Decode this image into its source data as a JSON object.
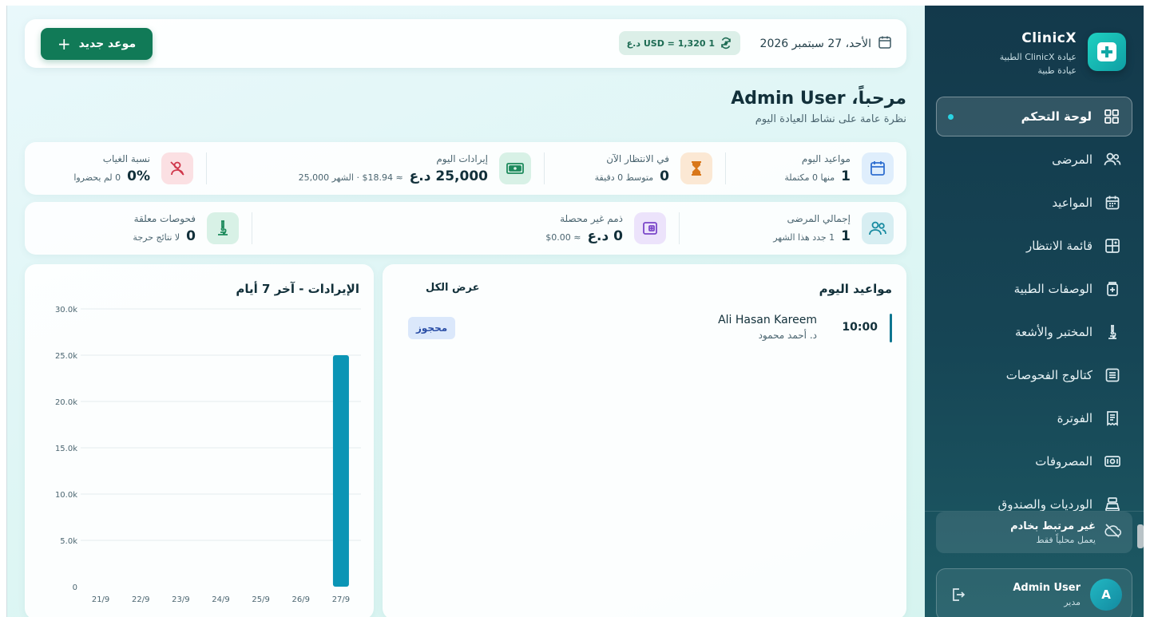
{
  "sidebar": {
    "brand_name": "ClinicX",
    "brand_sub1": "عيادة ClinicX الطبية",
    "brand_sub2": "عيادة طبية",
    "items": [
      {
        "label": "لوحة التحكم",
        "icon": "dashboard-icon",
        "active": true
      },
      {
        "label": "المرضى",
        "icon": "patients-icon"
      },
      {
        "label": "المواعيد",
        "icon": "calendar-icon"
      },
      {
        "label": "قائمة الانتظار",
        "icon": "queue-icon"
      },
      {
        "label": "الوصفات الطبية",
        "icon": "prescription-icon"
      },
      {
        "label": "المختبر والأشعة",
        "icon": "microscope-icon"
      },
      {
        "label": "كتالوج الفحوصات",
        "icon": "catalog-icon"
      },
      {
        "label": "الفوترة",
        "icon": "invoice-icon"
      },
      {
        "label": "المصروفات",
        "icon": "expenses-icon"
      },
      {
        "label": "الورديات والصندوق",
        "icon": "cash-register-icon"
      }
    ],
    "offline_title": "غير مرتبط بخادم",
    "offline_sub": "يعمل محلياً فقط",
    "user_name": "Admin User",
    "user_role": "مدير",
    "user_initial": "A"
  },
  "topbar": {
    "date": "الأحد، 27 سبتمبر 2026",
    "rate": "1 USD = 1,320 د.ع",
    "new_appointment": "موعد جديد"
  },
  "welcome": {
    "greeting": "مرحباً،",
    "name": "Admin User",
    "subtitle": "نظرة عامة على نشاط العيادة اليوم"
  },
  "stats_row1": [
    {
      "label": "مواعيد اليوم",
      "value": "1",
      "sub": "منها 0 مكتملة",
      "icon": "calendar-icon",
      "color": "#2f6fd0"
    },
    {
      "label": "في الانتظار الآن",
      "value": "0",
      "sub": "متوسط 0 دقيقة",
      "icon": "hourglass-icon",
      "color": "#d9771a"
    },
    {
      "label": "إيرادات اليوم",
      "value": "25,000 د.ع",
      "sub": "≈ $18.94 · الشهر 25,000",
      "icon": "cash-icon",
      "color": "#1d8a5c"
    },
    {
      "label": "نسبة الغياب",
      "value": "0%",
      "sub": "0 لم يحضروا",
      "icon": "user-x-icon",
      "color": "#d0374b"
    }
  ],
  "stats_row2": [
    {
      "label": "إجمالي المرضى",
      "value": "1",
      "sub": "1 جدد هذا الشهر",
      "icon": "users-icon",
      "color": "#178aa0"
    },
    {
      "label": "ذمم غير محصلة",
      "value": "0 د.ع",
      "sub": "≈ $0.00",
      "icon": "wallet-icon",
      "color": "#7a46c9"
    },
    {
      "label": "فحوصات معلقة",
      "value": "0",
      "sub": "لا نتائج حرجة",
      "icon": "microscope-icon",
      "color": "#1d8a5c"
    }
  ],
  "appointments": {
    "title": "مواعيد اليوم",
    "view_all": "عرض الكل",
    "rows": [
      {
        "time": "10:00",
        "patient": "Ali Hasan Kareem",
        "doctor": "د. أحمد محمود",
        "status": "محجوز"
      }
    ]
  },
  "chart_data": {
    "type": "bar",
    "title": "الإيرادات - آخر 7 أيام",
    "categories": [
      "21/9",
      "22/9",
      "23/9",
      "24/9",
      "25/9",
      "26/9",
      "27/9"
    ],
    "values": [
      0,
      0,
      0,
      0,
      0,
      0,
      25000
    ],
    "ylim": [
      0,
      30000
    ],
    "yticks": [
      0,
      5000,
      10000,
      15000,
      20000,
      25000,
      30000
    ],
    "ytick_labels": [
      "0",
      "5.0k",
      "10.0k",
      "15.0k",
      "20.0k",
      "25.0k",
      "30.0k"
    ],
    "grid": true,
    "color": "#0b95b5"
  }
}
